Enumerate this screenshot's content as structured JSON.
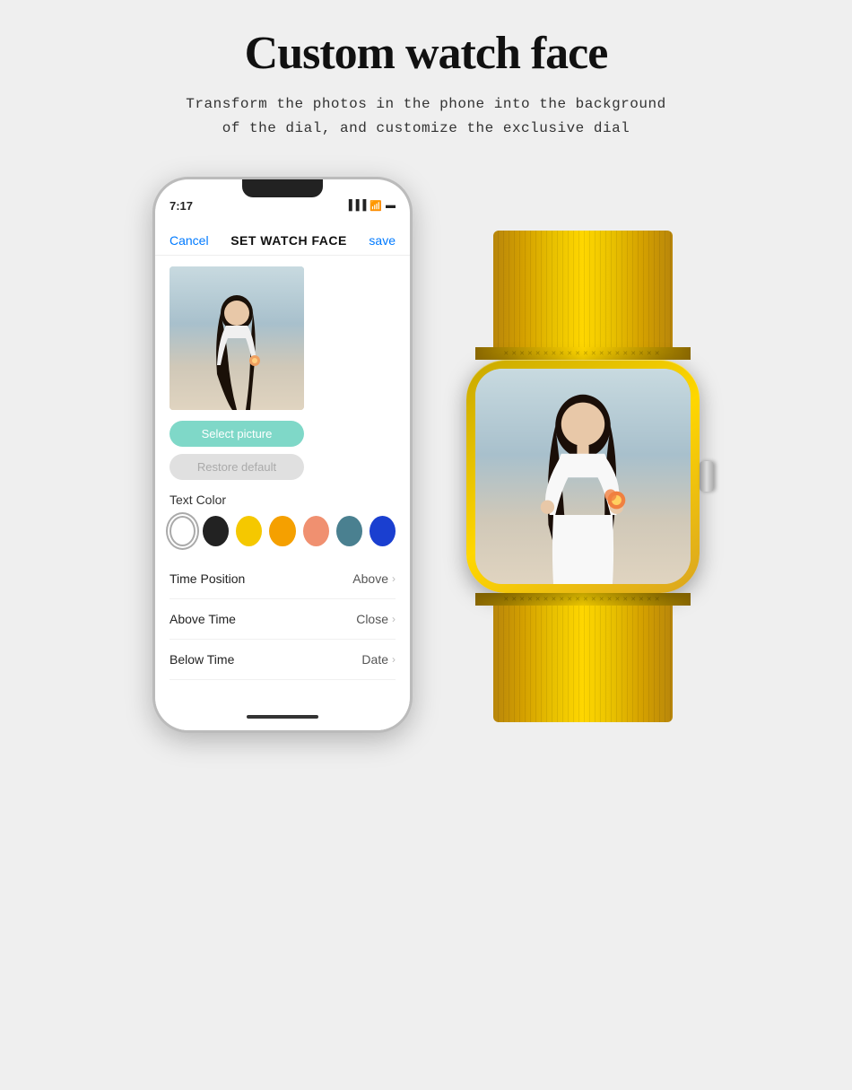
{
  "page": {
    "title": "Custom watch face",
    "subtitle_line1": "Transform the photos in the phone into the background",
    "subtitle_line2": "of the dial, and customize the exclusive dial"
  },
  "phone": {
    "time": "7:17",
    "header": {
      "cancel": "Cancel",
      "title": "SET WATCH FACE",
      "save": "save"
    },
    "buttons": {
      "select_picture": "Select picture",
      "restore_default": "Restore default"
    },
    "text_color_label": "Text Color",
    "colors": [
      {
        "name": "white",
        "hex": "#ffffff",
        "selected": true
      },
      {
        "name": "black",
        "hex": "#222222",
        "selected": false
      },
      {
        "name": "yellow",
        "hex": "#f5c800",
        "selected": false
      },
      {
        "name": "orange",
        "hex": "#f5a000",
        "selected": false
      },
      {
        "name": "peach",
        "hex": "#f09070",
        "selected": false
      },
      {
        "name": "teal",
        "hex": "#4a8090",
        "selected": false
      },
      {
        "name": "blue",
        "hex": "#1a3fd0",
        "selected": false
      }
    ],
    "settings": [
      {
        "label": "Time Position",
        "value": "Above"
      },
      {
        "label": "Above Time",
        "value": "Close"
      },
      {
        "label": "Below Time",
        "value": "Date"
      }
    ]
  },
  "watch": {
    "band_color": "#ffd700",
    "screen_description": "Custom watch face preview with girl photo background"
  }
}
